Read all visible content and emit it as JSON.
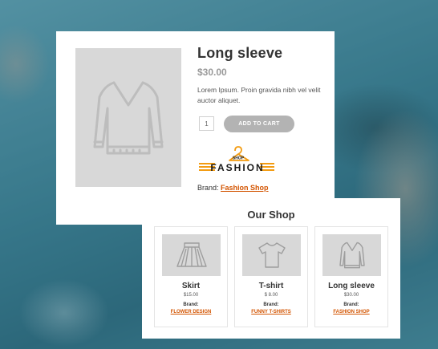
{
  "product": {
    "title": "Long sleeve",
    "price": "$30.00",
    "description": "Lorem Ipsum. Proin gravida nibh vel velit auctor aliquet.",
    "quantity": "1",
    "add_to_cart_label": "ADD TO CART",
    "brand_label": "Brand:",
    "brand_name": "Fashion Shop",
    "brand_logo": {
      "top_text": "SHOP",
      "main_text": "FASHION",
      "color": "#f39c12",
      "dark_color": "#1a1a1a"
    },
    "image_icon": "sweater-icon"
  },
  "shop": {
    "title": "Our Shop",
    "items": [
      {
        "name": "Skirt",
        "price": "$15.00",
        "brand_label": "Brand:",
        "brand": "FLOWER DESIGN",
        "icon": "skirt-icon"
      },
      {
        "name": "T-shirt",
        "price": "$ 8.00",
        "brand_label": "Brand:",
        "brand": "FUNNY T-SHIRTS",
        "icon": "tshirt-icon"
      },
      {
        "name": "Long sleeve",
        "price": "$30.00",
        "brand_label": "Brand:",
        "brand": "FASHION SHOP",
        "icon": "sweater-icon"
      }
    ]
  },
  "colors": {
    "accent": "#d35400",
    "button": "#b3b3b3",
    "placeholder": "#d8d8d8"
  }
}
